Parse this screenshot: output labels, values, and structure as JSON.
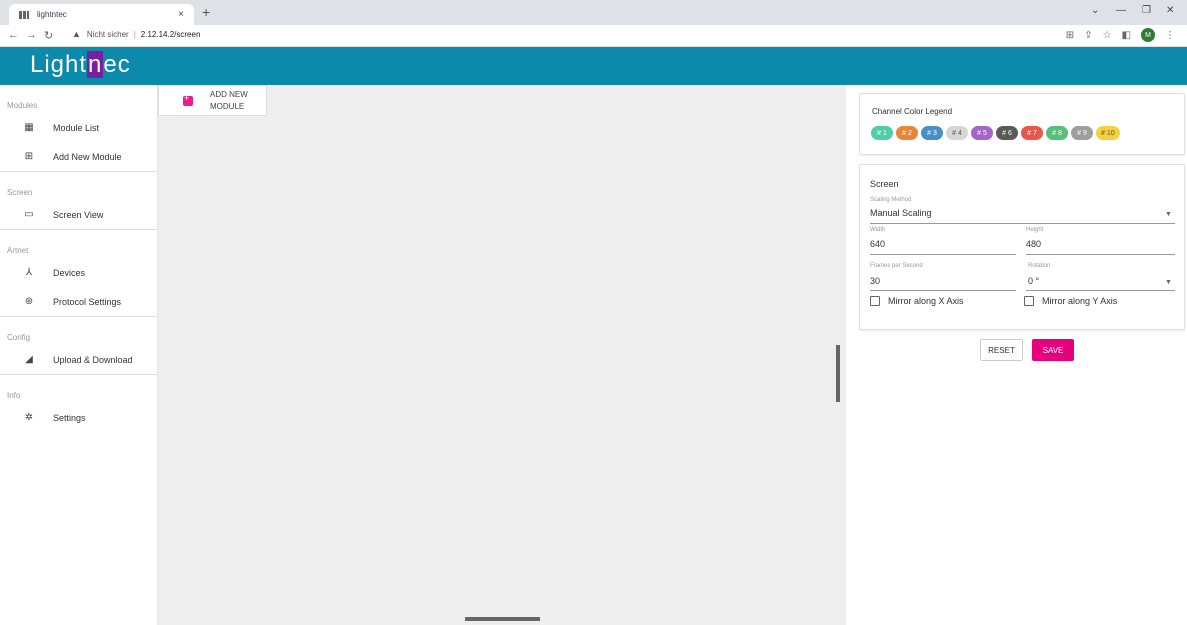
{
  "browser": {
    "tab_title": "lightntec",
    "tab_close": "×",
    "new_tab": "+",
    "security": "Nicht sicher",
    "url": "2.12.14.2/screen",
    "profile_initial": "M"
  },
  "app": {
    "logo_pre": "Light",
    "logo_mark": "n",
    "logo_post": "ec"
  },
  "sidebar": {
    "sections": [
      {
        "title": "Modules",
        "items": [
          {
            "label": "Module List",
            "icon": "grid-icon"
          },
          {
            "label": "Add New Module",
            "icon": "add-box-icon"
          }
        ]
      },
      {
        "title": "Screen",
        "items": [
          {
            "label": "Screen View",
            "icon": "monitor-icon"
          }
        ]
      },
      {
        "title": "Artnet",
        "items": [
          {
            "label": "Devices",
            "icon": "hub-icon"
          },
          {
            "label": "Protocol Settings",
            "icon": "dmx-connector-icon"
          }
        ]
      },
      {
        "title": "Config",
        "items": [
          {
            "label": "Upload & Download",
            "icon": "signal-gear-icon"
          }
        ]
      },
      {
        "title": "Info",
        "items": [
          {
            "label": "Settings",
            "icon": "gear-icon"
          }
        ]
      }
    ]
  },
  "main": {
    "add_module_label": "ADD NEW MODULE"
  },
  "legend": {
    "title": "Channel Color Legend",
    "chips": [
      {
        "label": "# 1",
        "color": "#4fcfa8"
      },
      {
        "label": "# 2",
        "color": "#e8873a"
      },
      {
        "label": "# 3",
        "color": "#4a90c8"
      },
      {
        "label": "# 4",
        "color": "#d6d6d6"
      },
      {
        "label": "# 5",
        "color": "#a664c8"
      },
      {
        "label": "# 6",
        "color": "#5a5a5a"
      },
      {
        "label": "# 7",
        "color": "#e8584a"
      },
      {
        "label": "# 8",
        "color": "#56c07a"
      },
      {
        "label": "# 9",
        "color": "#9e9e9e"
      },
      {
        "label": "# 10",
        "color": "#f5d03c"
      }
    ]
  },
  "screen": {
    "title": "Screen",
    "scaling_label": "Scaling Method",
    "scaling_value": "Manual Scaling",
    "width_label": "Width",
    "width_value": "640",
    "height_label": "Height",
    "height_value": "480",
    "fps_label": "Frames per Second",
    "fps_value": "30",
    "rotation_label": "Rotation",
    "rotation_value": "0 °",
    "mirror_x": "Mirror along X Axis",
    "mirror_y": "Mirror along Y Axis"
  },
  "actions": {
    "reset": "RESET",
    "save": "SAVE"
  }
}
